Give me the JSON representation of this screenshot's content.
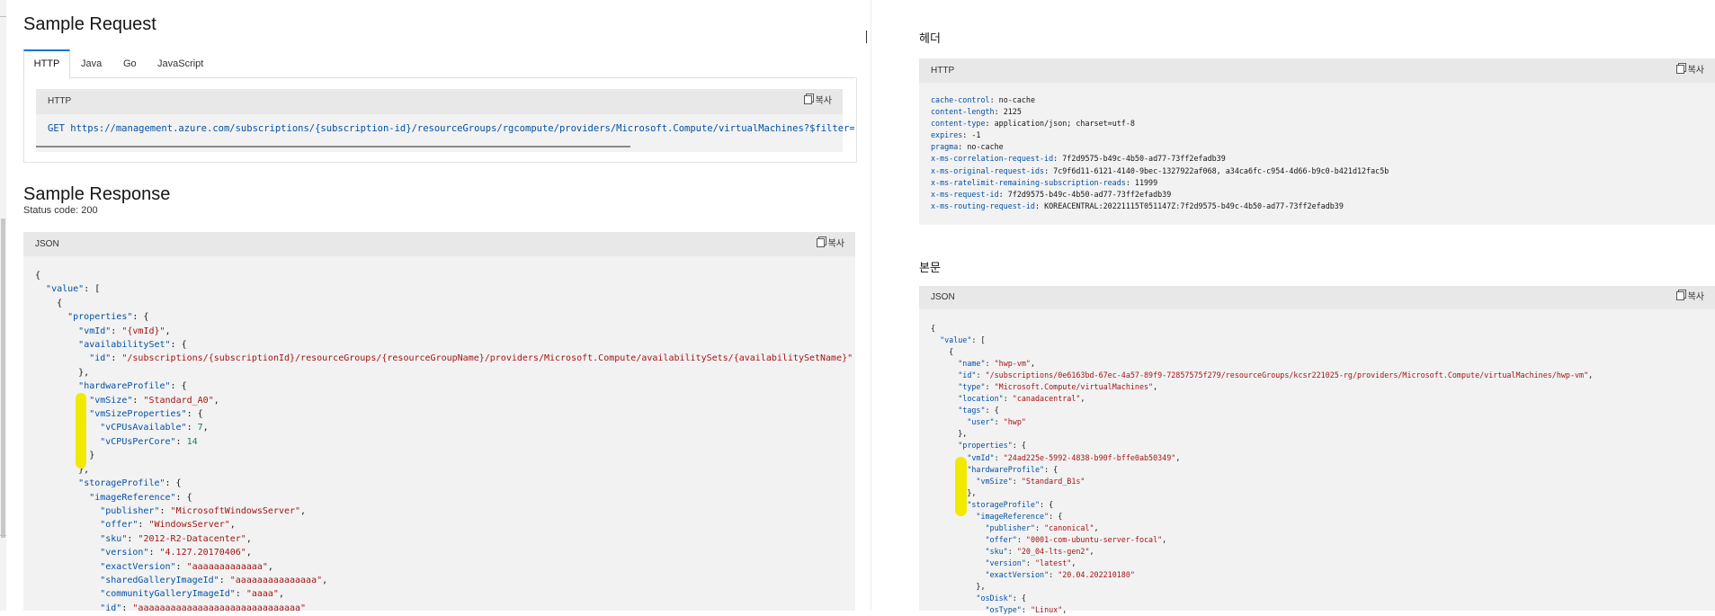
{
  "left": {
    "sample_request_title": "Sample Request",
    "tabs": [
      {
        "label": "HTTP"
      },
      {
        "label": "Java"
      },
      {
        "label": "Go"
      },
      {
        "label": "JavaScript"
      }
    ],
    "request_box": {
      "header": "HTTP",
      "copy_label": "복사",
      "get_line": "GET https://management.azure.com/subscriptions/{subscription-id}/resourceGroups/rgcompute/providers/Microsoft.Compute/virtualMachines?$filter=aaaaaaaaaaaaaaaaaaaaaaaaaaaaaaaaaa"
    },
    "sample_response_title": "Sample Response",
    "status_code": "Status code:  200",
    "json_box": {
      "header": "JSON",
      "copy_label": "복사",
      "lines": [
        "{",
        "  \"value\": [",
        "    {",
        "      \"properties\": {",
        "        \"vmId\": \"{vmId}\",",
        "        \"availabilitySet\": {",
        "          \"id\": \"/subscriptions/{subscriptionId}/resourceGroups/{resourceGroupName}/providers/Microsoft.Compute/availabilitySets/{availabilitySetName}\"",
        "        },",
        "        \"hardwareProfile\": {",
        "          \"vmSize\": \"Standard_A0\",",
        "          \"vmSizeProperties\": {",
        "            \"vCPUsAvailable\": 7,",
        "            \"vCPUsPerCore\": 14",
        "          }",
        "        },",
        "        \"storageProfile\": {",
        "          \"imageReference\": {",
        "            \"publisher\": \"MicrosoftWindowsServer\",",
        "            \"offer\": \"WindowsServer\",",
        "            \"sku\": \"2012-R2-Datacenter\",",
        "            \"version\": \"4.127.20170406\",",
        "            \"exactVersion\": \"aaaaaaaaaaaaa\",",
        "            \"sharedGalleryImageId\": \"aaaaaaaaaaaaaaa\",",
        "            \"communityGalleryImageId\": \"aaaa\",",
        "            \"id\": \"aaaaaaaaaaaaaaaaaaaaaaaaaaaaaa\""
      ]
    }
  },
  "right": {
    "headers_title": "헤더",
    "headers_box": {
      "header": "HTTP",
      "copy_label": "복사",
      "lines": [
        {
          "key": "cache-control",
          "value": "no-cache"
        },
        {
          "key": "content-length",
          "value": "2125"
        },
        {
          "key": "content-type",
          "value": "application/json; charset=utf-8"
        },
        {
          "key": "expires",
          "value": "-1"
        },
        {
          "key": "pragma",
          "value": "no-cache"
        },
        {
          "key": "x-ms-correlation-request-id",
          "value": "7f2d9575-b49c-4b50-ad77-73ff2efadb39"
        },
        {
          "key": "x-ms-original-request-ids",
          "value": "7c9f6d11-6121-4140-9bec-1327922af068, a34ca6fc-c954-4d66-b9c0-b421d12fac5b"
        },
        {
          "key": "x-ms-ratelimit-remaining-subscription-reads",
          "value": "11999"
        },
        {
          "key": "x-ms-request-id",
          "value": "7f2d9575-b49c-4b50-ad77-73ff2efadb39"
        },
        {
          "key": "x-ms-routing-request-id",
          "value": "KOREACENTRAL:20221115T051147Z:7f2d9575-b49c-4b50-ad77-73ff2efadb39"
        }
      ]
    },
    "body_title": "본문",
    "body_box": {
      "header": "JSON",
      "copy_label": "복사",
      "lines": [
        "{",
        "  \"value\": [",
        "    {",
        "      \"name\": \"hwp-vm\",",
        "      \"id\": \"/subscriptions/0e6163bd-67ec-4a57-89f9-72857575f279/resourceGroups/kcsr221025-rg/providers/Microsoft.Compute/virtualMachines/hwp-vm\",",
        "      \"type\": \"Microsoft.Compute/virtualMachines\",",
        "      \"location\": \"canadacentral\",",
        "      \"tags\": {",
        "        \"user\": \"hwp\"",
        "      },",
        "      \"properties\": {",
        "        \"vmId\": \"24ad225e-5992-4838-b90f-bffe0ab50349\",",
        "        \"hardwareProfile\": {",
        "          \"vmSize\": \"Standard_B1s\"",
        "        },",
        "        \"storageProfile\": {",
        "          \"imageReference\": {",
        "            \"publisher\": \"canonical\",",
        "            \"offer\": \"0001-com-ubuntu-server-focal\",",
        "            \"sku\": \"20_04-lts-gen2\",",
        "            \"version\": \"latest\",",
        "            \"exactVersion\": \"20.04.202210180\"",
        "          },",
        "          \"osDisk\": {",
        "            \"osType\": \"Linux\","
      ]
    }
  },
  "colors": {
    "accent": "#0078d4",
    "json_key": "#0451a5",
    "json_string": "#a31515",
    "json_number": "#098658",
    "highlight": "#f1ea00"
  }
}
